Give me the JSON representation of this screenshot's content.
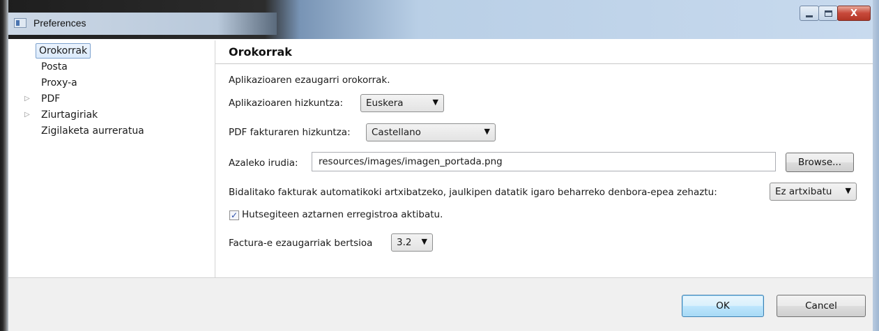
{
  "window": {
    "title": "Preferences",
    "controls": {
      "minimize": "minimize",
      "maximize": "maximize",
      "close": "X"
    }
  },
  "tree": {
    "items": [
      {
        "label": "Orokorrak",
        "selected": true,
        "expandable": false
      },
      {
        "label": "Posta",
        "selected": false,
        "expandable": false
      },
      {
        "label": "Proxy-a",
        "selected": false,
        "expandable": false
      },
      {
        "label": "PDF",
        "selected": false,
        "expandable": true
      },
      {
        "label": "Ziurtagiriak",
        "selected": false,
        "expandable": true
      },
      {
        "label": "Zigilaketa aurreratua",
        "selected": false,
        "expandable": false
      }
    ],
    "expander_glyph": "▷"
  },
  "panel": {
    "title": "Orokorrak",
    "description": "Aplikazioaren ezaugarri orokorrak.",
    "app_language": {
      "label": "Aplikazioaren hizkuntza:",
      "value": "Euskera"
    },
    "pdf_language": {
      "label": "PDF fakturaren hizkuntza:",
      "value": "Castellano"
    },
    "cover_image": {
      "label": "Azaleko irudia:",
      "value": "resources/images/imagen_portada.png",
      "browse_label": "Browse..."
    },
    "archive": {
      "label": "Bidalitako fakturak automatikoki artxibatzeko, jaulkipen datatik igaro beharreko denbora-epea zehaztu:",
      "value": "Ez artxibatu"
    },
    "error_log": {
      "label": "Hutsegiteen aztarnen erregistroa aktibatu.",
      "checked": true,
      "check_glyph": "✓"
    },
    "facturae_version": {
      "label": "Factura-e ezaugarriak bertsioa",
      "value": "3.2"
    },
    "dropdown_glyph": "▼"
  },
  "footer": {
    "ok_label": "OK",
    "cancel_label": "Cancel"
  }
}
